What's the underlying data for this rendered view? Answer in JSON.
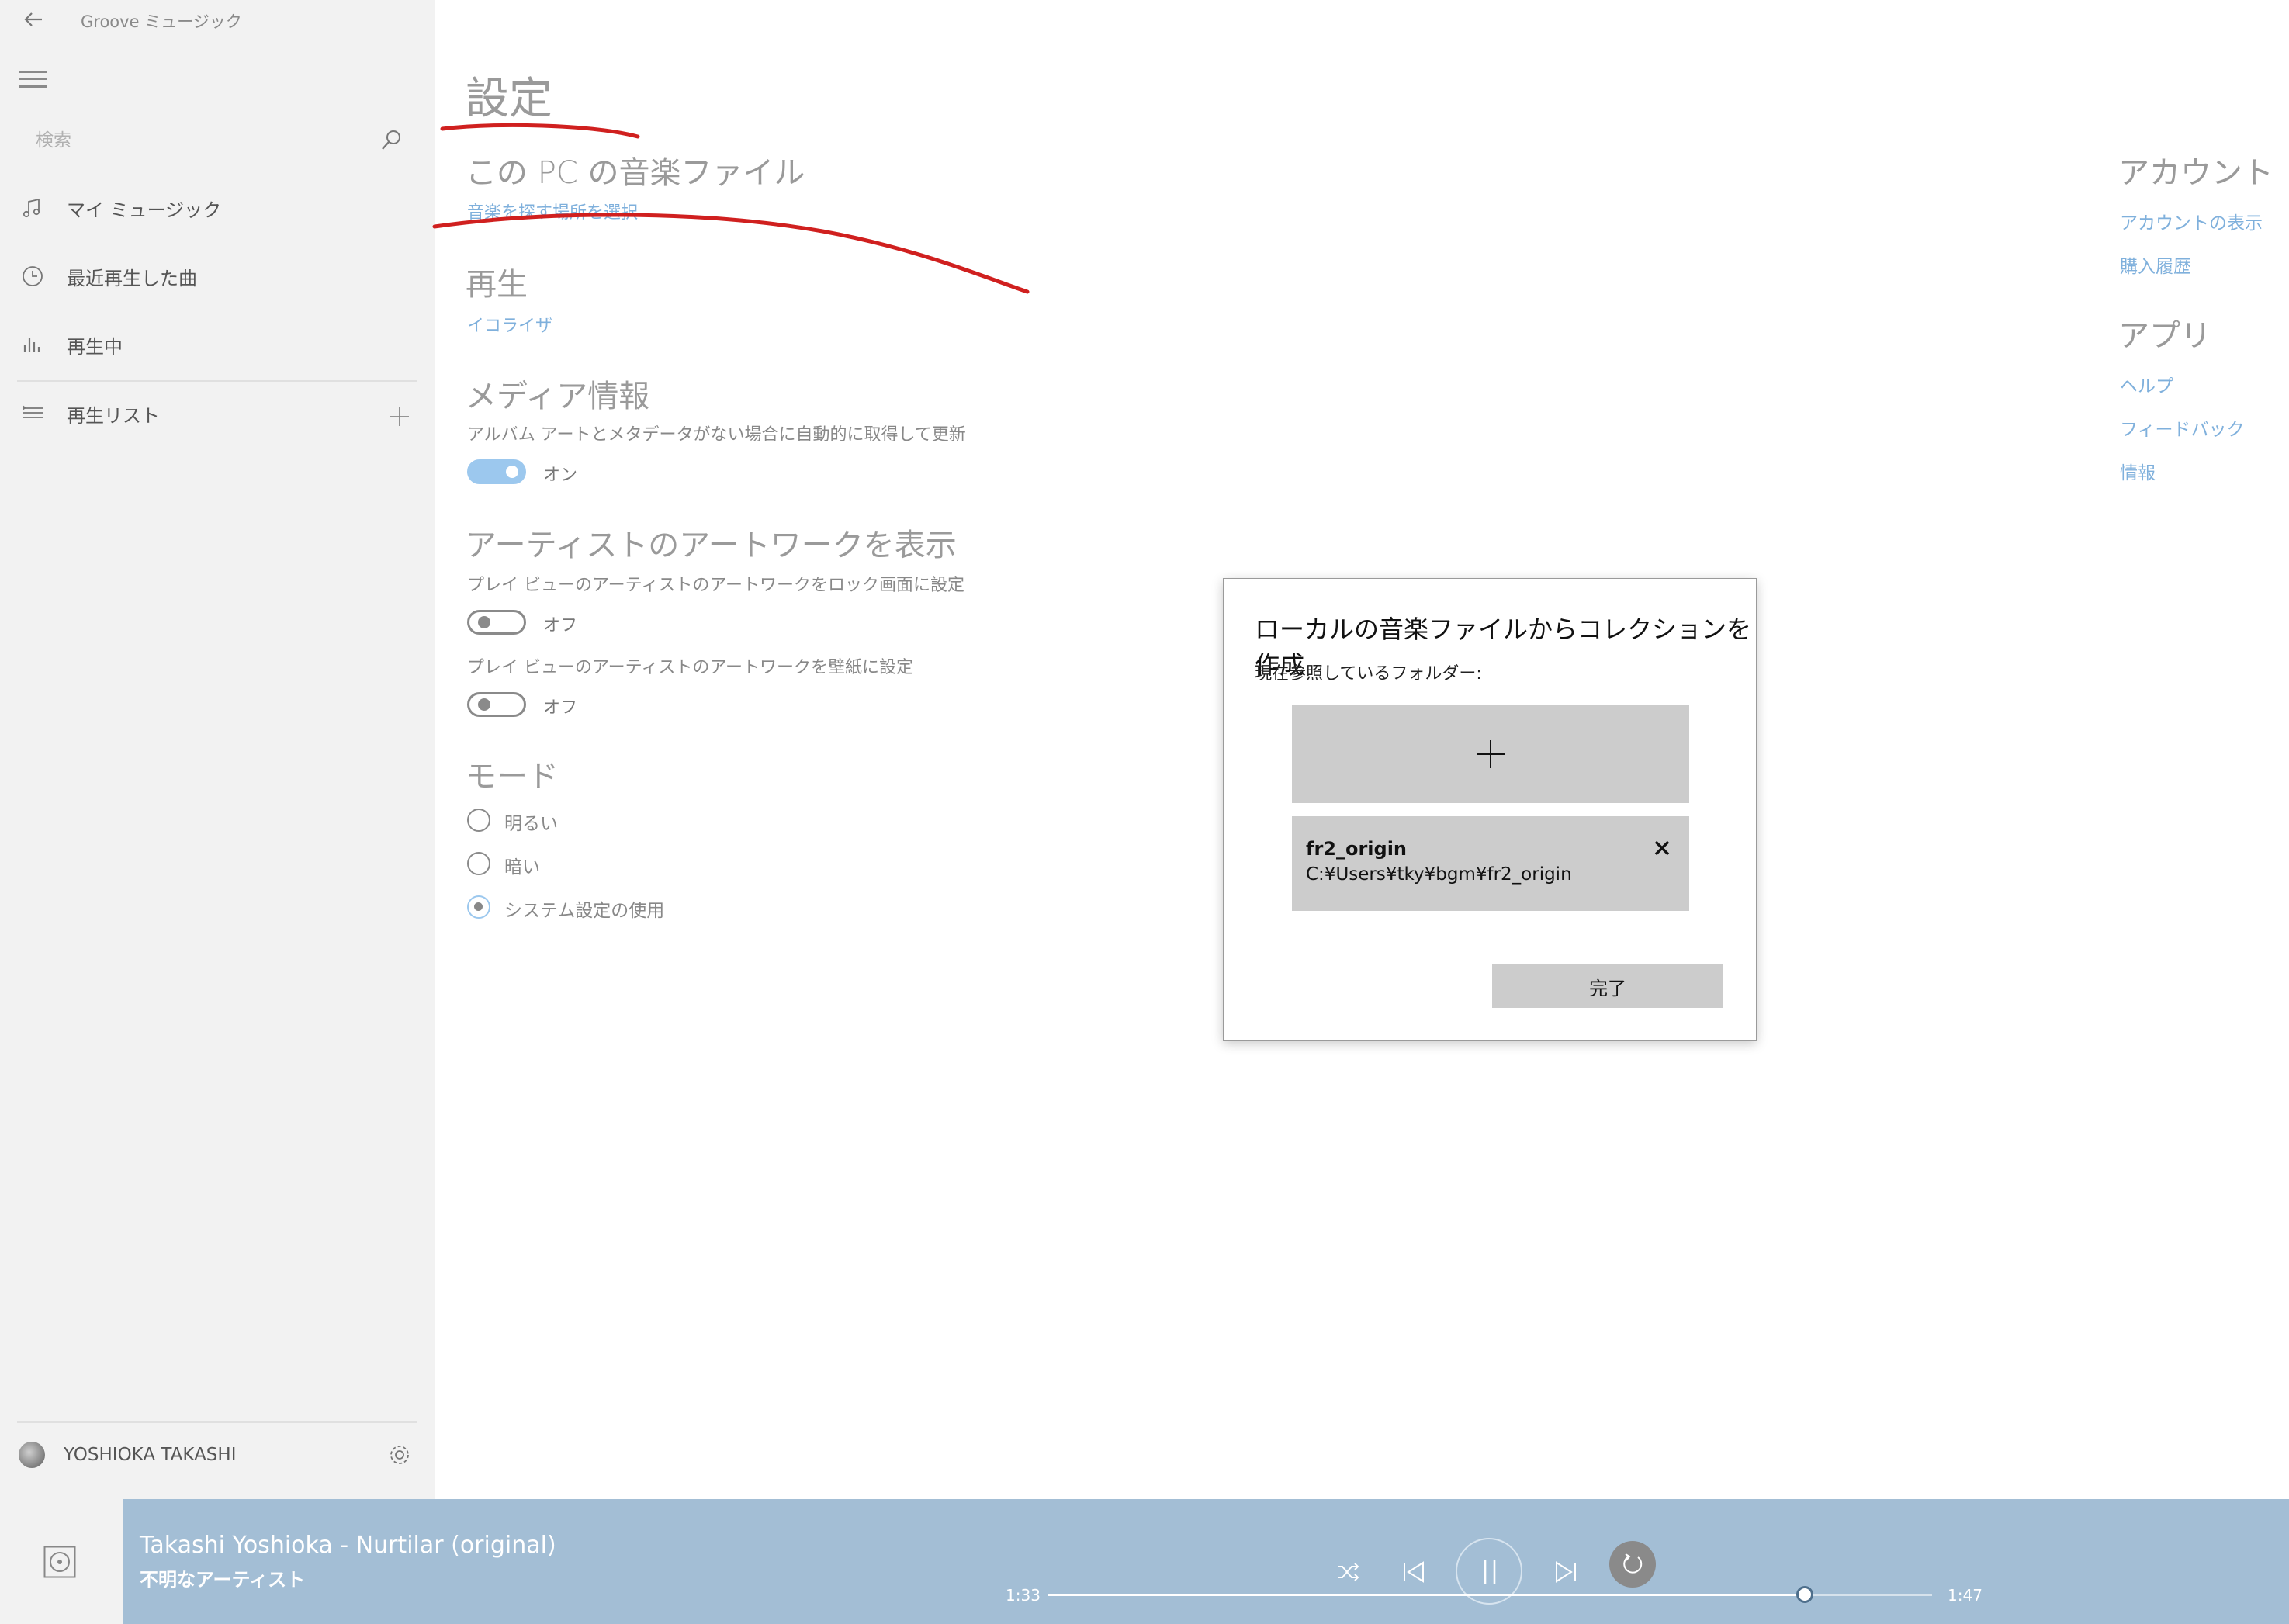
{
  "window": {
    "app_title": "Groove ミュージック"
  },
  "sidebar": {
    "search_placeholder": "検索",
    "items": [
      {
        "label": "マイ ミュージック",
        "icon": "music-note-icon"
      },
      {
        "label": "最近再生した曲",
        "icon": "clock-icon"
      },
      {
        "label": "再生中",
        "icon": "equalizer-bars-icon"
      },
      {
        "label": "再生リスト",
        "icon": "playlist-icon"
      }
    ],
    "user_name": "YOSHIOKA TAKASHI"
  },
  "settings": {
    "title": "設定",
    "local_files": {
      "heading": "この PC の音楽ファイル",
      "link": "音楽を探す場所を選択"
    },
    "playback": {
      "heading": "再生",
      "link": "イコライザ"
    },
    "media_info": {
      "heading": "メディア情報",
      "description": "アルバム アートとメタデータがない場合に自動的に取得して更新",
      "toggle_label": "オン",
      "toggle_on": true
    },
    "artist_art": {
      "heading": "アーティストのアートワークを表示",
      "lock_desc": "プレイ ビューのアーティストのアートワークをロック画面に設定",
      "lock_toggle_label": "オフ",
      "wallpaper_desc": "プレイ ビューのアーティストのアートワークを壁紙に設定",
      "wallpaper_toggle_label": "オフ"
    },
    "mode": {
      "heading": "モード",
      "options": [
        "明るい",
        "暗い",
        "システム設定の使用"
      ],
      "selected": "システム設定の使用"
    }
  },
  "right_panel": {
    "account_heading": "アカウント",
    "account_links": [
      "アカウントの表示",
      "購入履歴"
    ],
    "app_heading": "アプリ",
    "app_links": [
      "ヘルプ",
      "フィードバック",
      "情報"
    ]
  },
  "dialog": {
    "title": "ローカルの音楽ファイルからコレクションを作成",
    "subtitle": "現在参照しているフォルダー:",
    "folders": [
      {
        "name": "fr2_origin",
        "path": "C:¥Users¥tky¥bgm¥fr2_origin"
      }
    ],
    "done_label": "完了"
  },
  "player": {
    "track_title": "Takashi Yoshioka - Nurtilar (original)",
    "artist": "不明なアーティスト",
    "elapsed": "1:33",
    "total": "1:47",
    "progress_fraction": 0.856
  },
  "colors": {
    "accent": "#7fb0dc",
    "player_bar": "#a3bed5",
    "sidebar_bg": "#f2f2f2",
    "annotation_red": "#d0201f"
  }
}
